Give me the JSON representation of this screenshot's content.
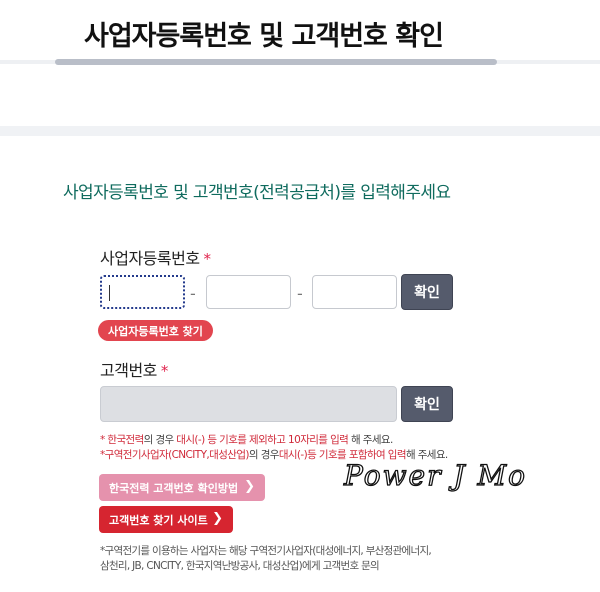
{
  "header": {
    "title": "사업자등록번호 및 고객번호 확인"
  },
  "form": {
    "subheading": "사업자등록번호 및 고객번호(전력공급처)를 입력해주세요",
    "business_number": {
      "label": "사업자등록번호",
      "required_mark": "*",
      "separator": "-",
      "confirm_label": "확인",
      "find_label": "사업자등록번호 찾기"
    },
    "customer_number": {
      "label": "고객번호",
      "required_mark": "*",
      "confirm_label": "확인",
      "note1_a": "* ",
      "note1_b": "한국전력",
      "note1_c": "의 경우 ",
      "note1_d": "대시(-) 등 기호를 제외하고 10자리를 입력",
      "note1_e": " 해 주세요.",
      "note2_a": "*",
      "note2_b": "구역전기사업자(CNCITY,대성산업)",
      "note2_c": "의 경우",
      "note2_d": "대시(-)등 기호를 포함하여 입력",
      "note2_e": "해 주세요.",
      "method_button": "한국전력 고객번호 확인방법",
      "site_button": "고객번호 찾기 사이트",
      "chevron": "❯"
    },
    "footer_note": {
      "line1": "*구역전기를 이용하는 사업자는 해당 구역전기사업자(대성에너지, 부산정관에너지,",
      "line2": "삼천리, JB, CNCITY, 한국지역난방공사, 대성산업)에게 고객번호 문의"
    }
  },
  "watermark": "Power J Mo",
  "colors": {
    "accent_green": "#0f6b5e",
    "required_red": "#e0244d",
    "button_dark": "#555b6c",
    "button_red": "#d62530",
    "button_pink": "#e592ad"
  }
}
